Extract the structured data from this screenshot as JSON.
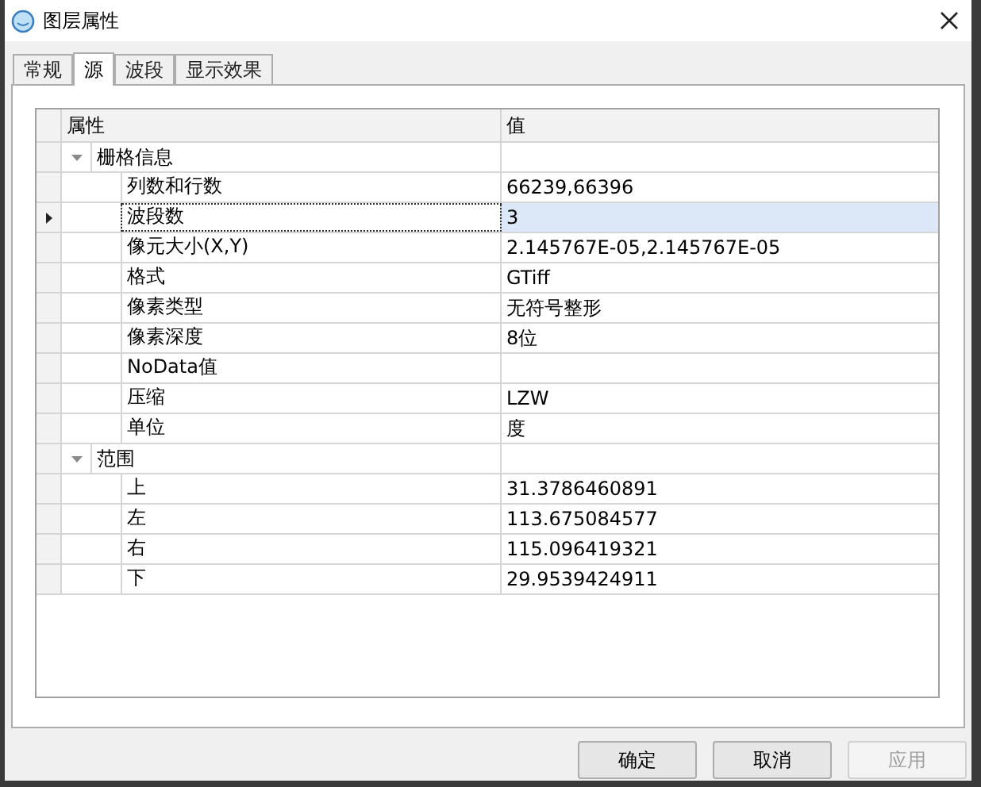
{
  "window": {
    "title": "图层属性"
  },
  "tabs": [
    {
      "label": "常规",
      "selected": false
    },
    {
      "label": "源",
      "selected": true
    },
    {
      "label": "波段",
      "selected": false
    },
    {
      "label": "显示效果",
      "selected": false
    }
  ],
  "grid": {
    "columns": [
      "属性",
      "值"
    ],
    "groups": [
      {
        "name": "栅格信息",
        "expanded": true,
        "rows": [
          {
            "name": "列数和行数",
            "value": "66239,66396",
            "selected": false
          },
          {
            "name": "波段数",
            "value": "3",
            "selected": true
          },
          {
            "name": "像元大小(X,Y)",
            "value": "2.145767E-05,2.145767E-05",
            "selected": false
          },
          {
            "name": "格式",
            "value": "GTiff",
            "selected": false
          },
          {
            "name": "像素类型",
            "value": "无符号整形",
            "selected": false
          },
          {
            "name": "像素深度",
            "value": "8位",
            "selected": false
          },
          {
            "name": "NoData值",
            "selected": false
          },
          {
            "name": "压缩",
            "value": "LZW",
            "selected": false
          },
          {
            "name": "单位",
            "value": "度",
            "selected": false
          }
        ]
      },
      {
        "name": "范围",
        "expanded": true,
        "rows": [
          {
            "name": "上",
            "value": "31.3786460891",
            "selected": false
          },
          {
            "name": "左",
            "value": "113.675084577",
            "selected": false
          },
          {
            "name": "右",
            "value": "115.096419321",
            "selected": false
          },
          {
            "name": "下",
            "value": "29.9539424911",
            "selected": false
          }
        ]
      }
    ]
  },
  "buttons": [
    {
      "label": "确定",
      "disabled": false
    },
    {
      "label": "取消",
      "disabled": false
    },
    {
      "label": "应用",
      "disabled": true
    }
  ]
}
